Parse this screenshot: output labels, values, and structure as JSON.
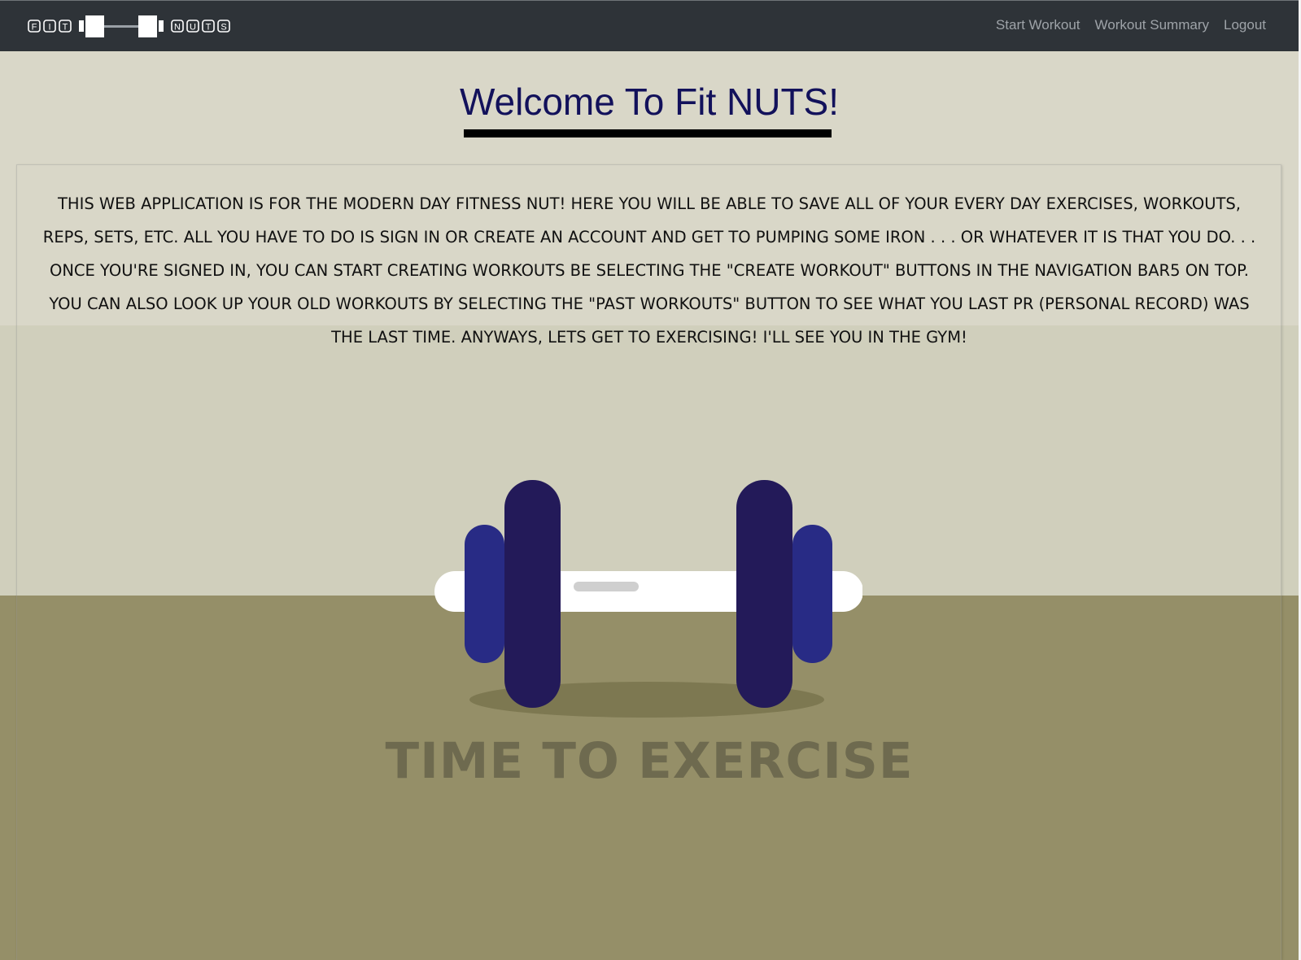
{
  "navbar": {
    "brand": {
      "left_letters": [
        "F",
        "I",
        "T"
      ],
      "right_letters": [
        "N",
        "U",
        "T",
        "S"
      ]
    },
    "links": [
      {
        "label": "Start Workout"
      },
      {
        "label": "Workout Summary"
      },
      {
        "label": "Logout"
      }
    ]
  },
  "main": {
    "title": "Welcome To Fit NUTS!",
    "intro": "This web application is for the modern day fitness nut! Here you will be able to save all of your every day exercises, workouts, reps, sets, etc. All you have to do is sign in or create an account and get to pumping some iron . . . or whatever it is that you do. . . Once you're signed in, you can start creating workouts be selecting the \"Create Workout\" buttons in the navigation bar5 on top. You can also look up your old workouts by selecting the \"Past Workouts\" button to see what you last PR (Personal Record) was the last time. Anyways, lets get to exercising! I'll see you in the gym!"
  },
  "illustration": {
    "tagline": "TIME TO EXERCISE",
    "colors": {
      "wall": "#d9d7c8",
      "floor": "#958f68",
      "outer_plate": "#282b85",
      "inner_plate": "#231a59",
      "bar": "#ffffff",
      "tagline": "#6e6a4f"
    }
  },
  "colors": {
    "navbar": "#2e3338",
    "nav_link": "#9ea3a8",
    "title": "#12115b"
  }
}
